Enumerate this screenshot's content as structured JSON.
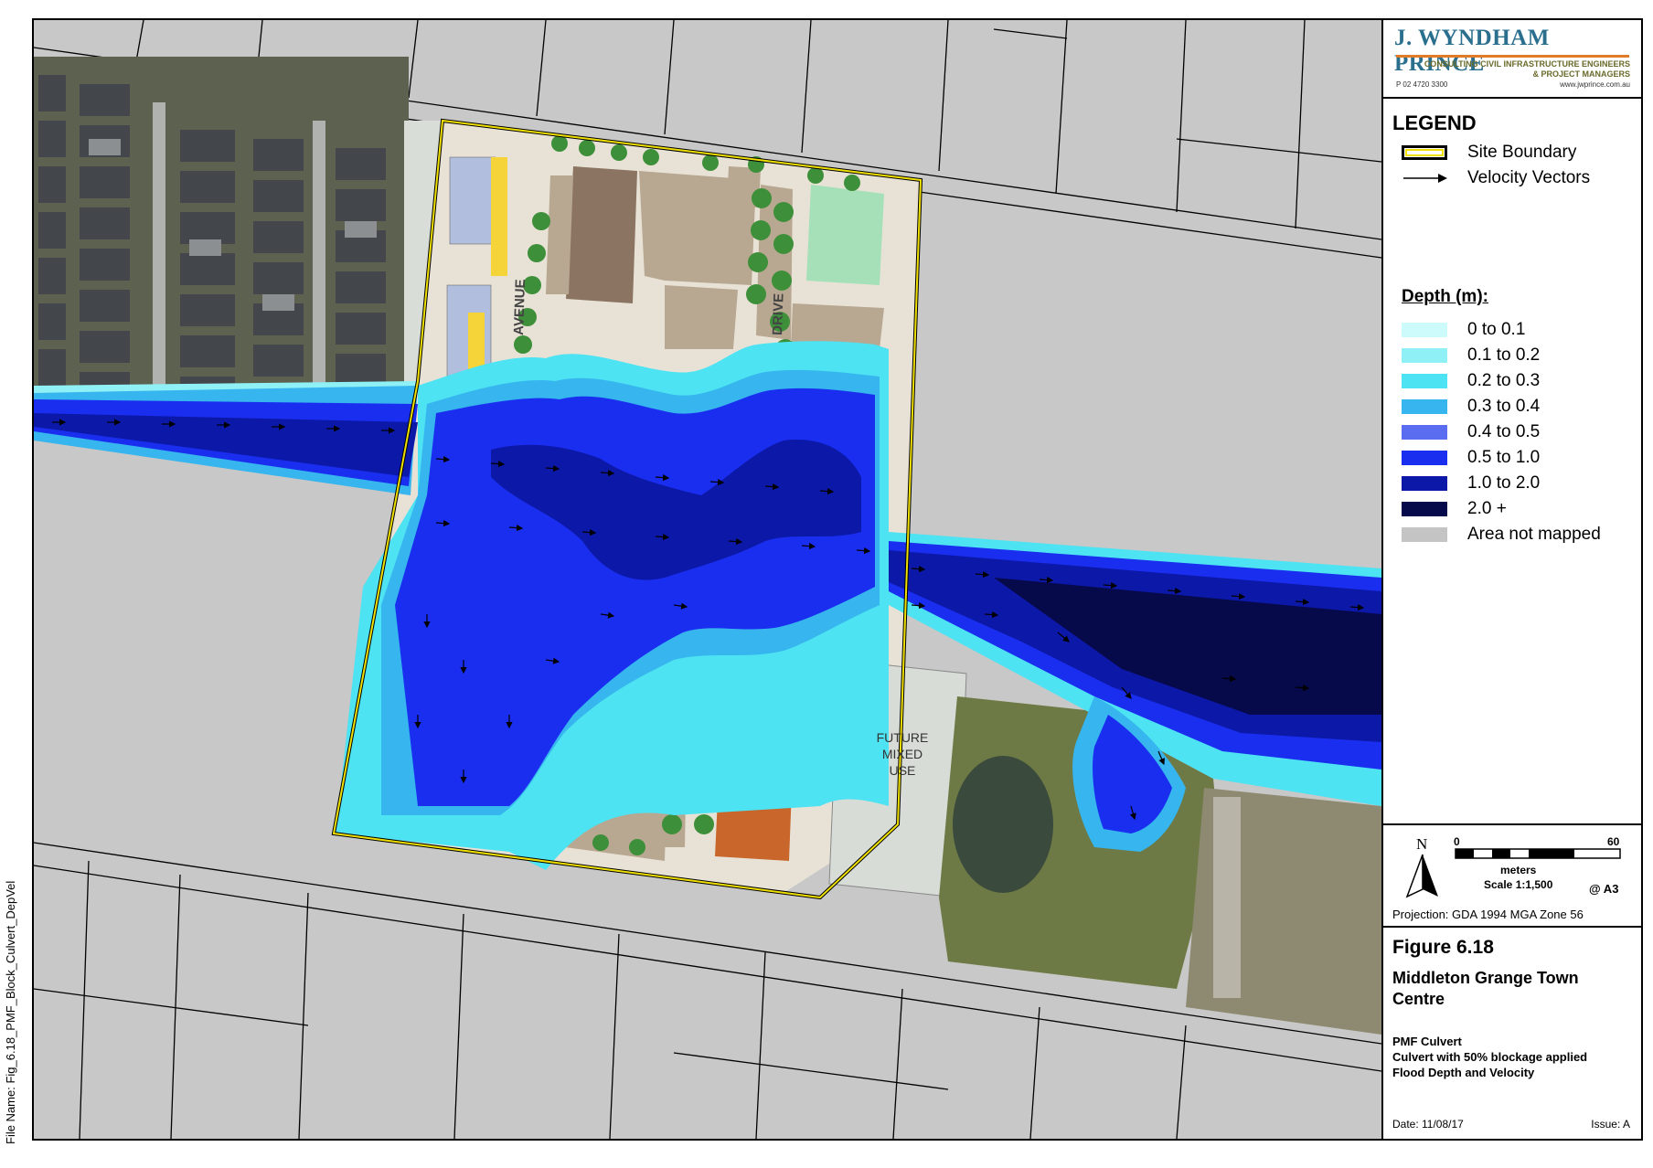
{
  "company": {
    "name": "J. WYNDHAM PRINCE",
    "tagline_1": "CONSULTING CIVIL INFRASTRUCTURE ENGINEERS",
    "tagline_2": "& PROJECT MANAGERS",
    "phone": "P 02 4720 3300",
    "website": "www.jwprince.com.au"
  },
  "legend": {
    "title": "LEGEND",
    "site_boundary": "Site Boundary",
    "velocity_vectors": "Velocity Vectors",
    "depth_title": "Depth (m):",
    "depth_classes": [
      {
        "label": "0 to 0.1",
        "color": "#cdfbfb"
      },
      {
        "label": "0.1 to 0.2",
        "color": "#8ff0f5"
      },
      {
        "label": "0.2 to 0.3",
        "color": "#4de3f2"
      },
      {
        "label": "0.3 to 0.4",
        "color": "#36b5ee"
      },
      {
        "label": "0.4 to 0.5",
        "color": "#5a6df0"
      },
      {
        "label": "0.5 to 1.0",
        "color": "#1a2ef0"
      },
      {
        "label": "1.0 to 2.0",
        "color": "#0c19a8"
      },
      {
        "label": "2.0 +",
        "color": "#06094a"
      }
    ],
    "not_mapped": {
      "label": "Area not mapped",
      "color": "#c4c4c4"
    }
  },
  "scale": {
    "north": "N",
    "min": "0",
    "max": "60",
    "units": "meters",
    "ratio": "Scale 1:1,500",
    "paper": "@ A3",
    "projection": "Projection: GDA 1994 MGA Zone 56"
  },
  "figure": {
    "number": "Figure 6.18",
    "title": "Middleton Grange Town Centre",
    "subtitle_1": "PMF Culvert",
    "subtitle_2": "Culvert with 50% blockage applied",
    "subtitle_3": "Flood Depth and Velocity",
    "date": "Date: 11/08/17",
    "issue": "Issue: A"
  },
  "file_name": "File Name: Fig_6.18_PMF_Block_Culvert_DepVel",
  "map_labels": {
    "avenue": "AVENUE",
    "drive": "DRIVE",
    "future_mixed_use_1": "FUTURE",
    "future_mixed_use_2": "MIXED",
    "future_mixed_use_3": "USE"
  },
  "colors": {
    "site_boundary": "#f0e000",
    "building": "#b8a791",
    "supermarket": "#8c7462",
    "lot5": "#c8662b",
    "tree": "#3e8f3a",
    "childcare": "#a6e0b8"
  }
}
